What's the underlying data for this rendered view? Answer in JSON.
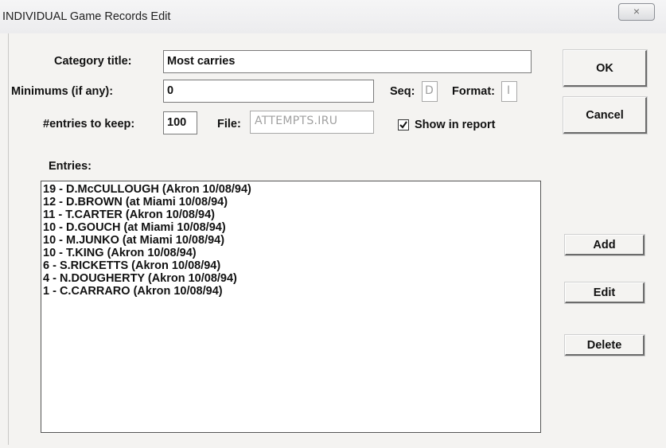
{
  "window": {
    "title": "INDIVIDUAL Game Records Edit",
    "close_glyph": "×"
  },
  "form": {
    "category_title_label": "Category title:",
    "category_title_value": "Most carries",
    "minimums_label": "Minimums (if any):",
    "minimums_value": "0",
    "seq_label": "Seq:",
    "seq_value": "D",
    "format_label": "Format:",
    "format_value": "I",
    "entries_to_keep_label": "#entries to keep:",
    "entries_to_keep_value": "100",
    "file_label": "File:",
    "file_value": "ATTEMPTS.IRU",
    "show_in_report_label": "Show in report",
    "show_in_report_checked": true
  },
  "buttons": {
    "ok": "OK",
    "cancel": "Cancel",
    "add": "Add",
    "edit": "Edit",
    "delete": "Delete"
  },
  "entries": {
    "label": "Entries:",
    "items": [
      "19 - D.McCULLOUGH (Akron 10/08/94)",
      "12 - D.BROWN (at Miami 10/08/94)",
      "11 - T.CARTER (Akron 10/08/94)",
      "10 - D.GOUCH (at Miami 10/08/94)",
      "10 - M.JUNKO (at Miami 10/08/94)",
      "10 - T.KING (Akron 10/08/94)",
      "6 - S.RICKETTS (Akron 10/08/94)",
      "4 - N.DOUGHERTY (Akron 10/08/94)",
      "1 - C.CARRARO (Akron 10/08/94)"
    ]
  }
}
